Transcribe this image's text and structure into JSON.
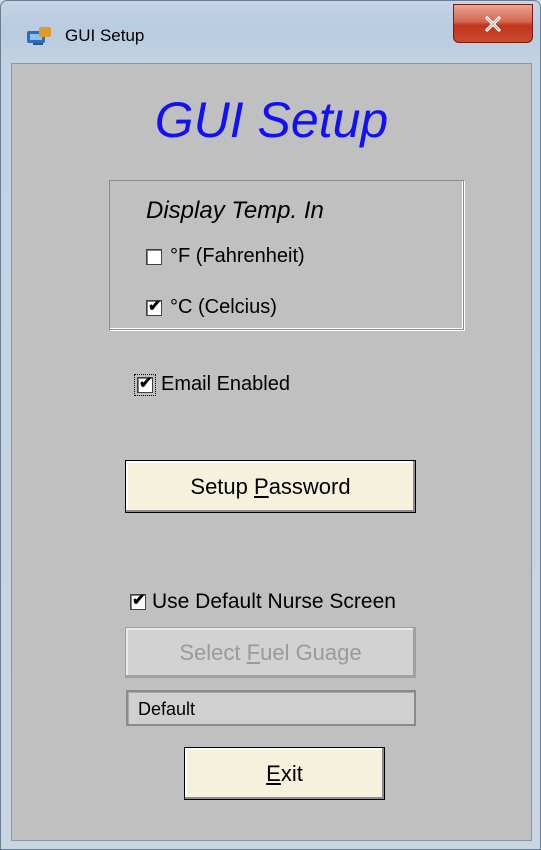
{
  "window": {
    "title": "GUI Setup",
    "close_label": "X"
  },
  "heading": "GUI Setup",
  "temp_group": {
    "title": "Display Temp. In",
    "fahrenheit": {
      "label": "°F (Fahrenheit)",
      "checked": false
    },
    "celsius": {
      "label": "°C (Celcius)",
      "checked": true
    }
  },
  "email": {
    "label": "Email Enabled",
    "checked": true
  },
  "setup_password": {
    "prefix": "Setup ",
    "mnemonic": "P",
    "suffix": "assword"
  },
  "nurse_screen": {
    "label": "Use Default  Nurse Screen",
    "checked": true
  },
  "select_fuel": {
    "prefix": "Select ",
    "mnemonic": "F",
    "suffix": "uel Guage",
    "enabled": false
  },
  "fuel_field": {
    "value": "Default"
  },
  "exit": {
    "mnemonic": "E",
    "suffix": "xit"
  },
  "check_glyph": "✔",
  "colors": {
    "heading": "#1010ff",
    "button_face": "#f5f1dc",
    "dialog_face": "#c0c0c0"
  }
}
